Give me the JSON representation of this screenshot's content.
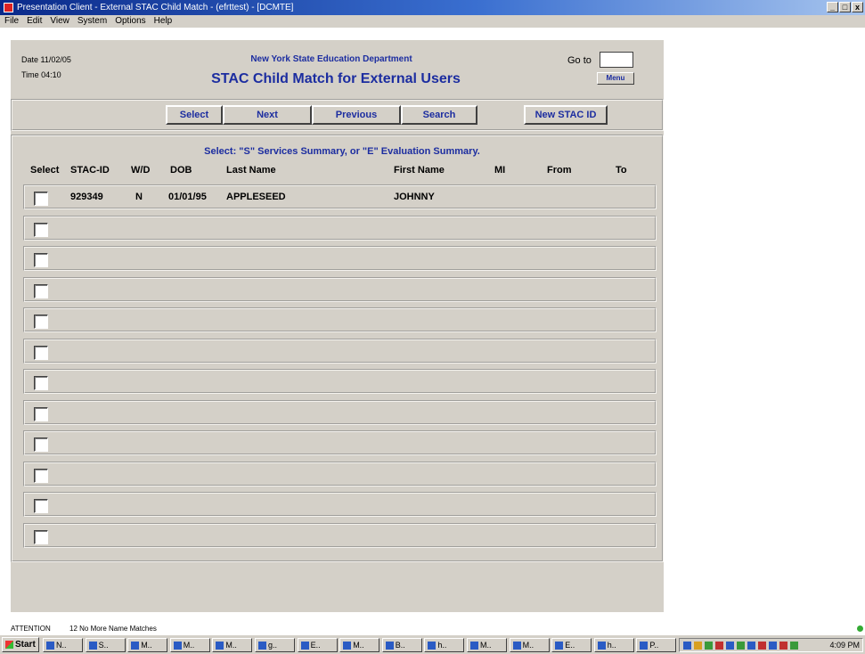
{
  "window": {
    "title": "Presentation Client - External STAC Child Match - (efrttest) - [DCMTE]",
    "controls": [
      "_",
      "□",
      "x"
    ]
  },
  "menubar": [
    "File",
    "Edit",
    "View",
    "System",
    "Options",
    "Help"
  ],
  "header": {
    "date": "Date 11/02/05",
    "time": "Time 04:10",
    "department": "New York State Education Department",
    "title": "STAC Child Match for External Users",
    "goto_label": "Go to",
    "goto_value": "",
    "menu_button": "Menu"
  },
  "buttons": {
    "select": "Select",
    "next": "Next",
    "previous": "Previous",
    "search": "Search",
    "new_stac_id": "New STAC ID"
  },
  "list": {
    "instruction": "Select: \"S\" Services Summary, or \"E\" Evaluation Summary.",
    "columns": {
      "select": "Select",
      "stac_id": "STAC-ID",
      "wd": "W/D",
      "dob": "DOB",
      "last_name": "Last Name",
      "first_name": "First Name",
      "mi": "MI",
      "from": "From",
      "to": "To"
    },
    "rows": [
      {
        "stac_id": "929349",
        "wd": "N",
        "dob": "01/01/95",
        "last_name": "APPLESEED",
        "first_name": "JOHNNY",
        "mi": "",
        "from": "",
        "to": ""
      },
      {
        "stac_id": "",
        "wd": "",
        "dob": "",
        "last_name": "",
        "first_name": "",
        "mi": "",
        "from": "",
        "to": ""
      },
      {
        "stac_id": "",
        "wd": "",
        "dob": "",
        "last_name": "",
        "first_name": "",
        "mi": "",
        "from": "",
        "to": ""
      },
      {
        "stac_id": "",
        "wd": "",
        "dob": "",
        "last_name": "",
        "first_name": "",
        "mi": "",
        "from": "",
        "to": ""
      },
      {
        "stac_id": "",
        "wd": "",
        "dob": "",
        "last_name": "",
        "first_name": "",
        "mi": "",
        "from": "",
        "to": ""
      },
      {
        "stac_id": "",
        "wd": "",
        "dob": "",
        "last_name": "",
        "first_name": "",
        "mi": "",
        "from": "",
        "to": ""
      },
      {
        "stac_id": "",
        "wd": "",
        "dob": "",
        "last_name": "",
        "first_name": "",
        "mi": "",
        "from": "",
        "to": ""
      },
      {
        "stac_id": "",
        "wd": "",
        "dob": "",
        "last_name": "",
        "first_name": "",
        "mi": "",
        "from": "",
        "to": ""
      },
      {
        "stac_id": "",
        "wd": "",
        "dob": "",
        "last_name": "",
        "first_name": "",
        "mi": "",
        "from": "",
        "to": ""
      },
      {
        "stac_id": "",
        "wd": "",
        "dob": "",
        "last_name": "",
        "first_name": "",
        "mi": "",
        "from": "",
        "to": ""
      },
      {
        "stac_id": "",
        "wd": "",
        "dob": "",
        "last_name": "",
        "first_name": "",
        "mi": "",
        "from": "",
        "to": ""
      },
      {
        "stac_id": "",
        "wd": "",
        "dob": "",
        "last_name": "",
        "first_name": "",
        "mi": "",
        "from": "",
        "to": ""
      }
    ]
  },
  "status": {
    "label": "ATTENTION",
    "message": "12 No More Name Matches"
  },
  "taskbar": {
    "start": "Start",
    "tasks": [
      "N..",
      "S..",
      "M..",
      "M..",
      "M..",
      "g..",
      "E..",
      "M..",
      "B..",
      "h..",
      "M..",
      "M..",
      "E..",
      "h..",
      "P.."
    ],
    "clock": "4:09 PM"
  },
  "colors": {
    "accent_blue": "#1c2da0",
    "panel_gray": "#d4d0c8",
    "titlebar_blue": "#0a2a8a"
  }
}
